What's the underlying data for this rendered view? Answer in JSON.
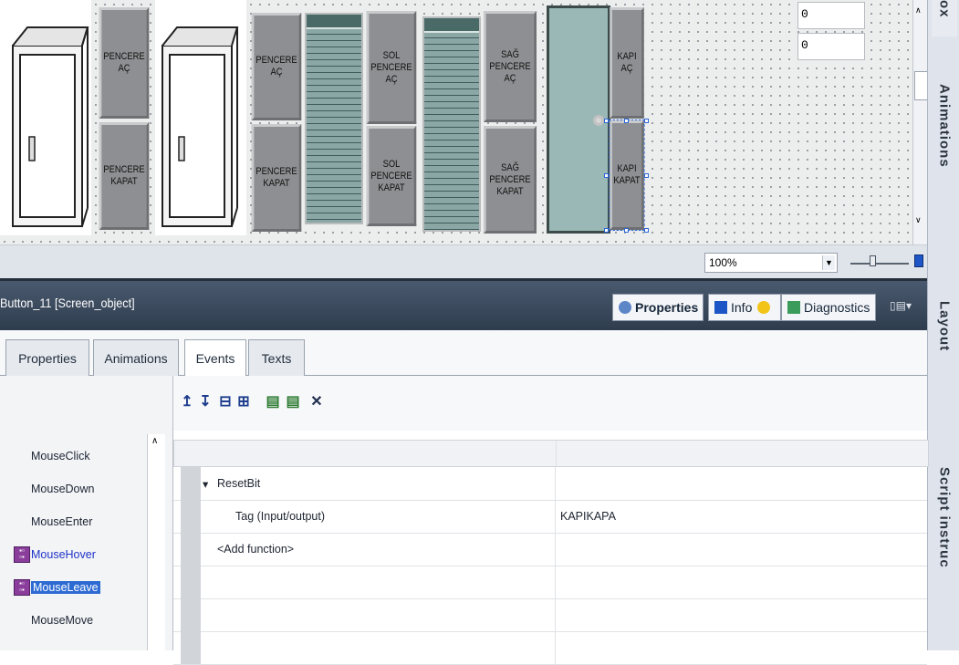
{
  "canvas": {
    "buttons": {
      "window1_open": "PENCERE\nAÇ",
      "window1_close": "PENCERE\nKAPAT",
      "window2_open": "PENCERE\nAÇ",
      "window2_close": "PENCERE\nKAPAT",
      "left_window_open": "SOL\nPENCERE\nAÇ",
      "left_window_close": "SOL\nPENCERE\nKAPAT",
      "right_window_open": "SAĞ\nPENCERE\nAÇ",
      "right_window_close": "SAĞ\nPENCERE\nKAPAT",
      "door_open": "KAPI\nAÇ",
      "door_close": "KAPI\nKAPAT"
    },
    "io_fields": [
      "0",
      "0"
    ]
  },
  "zoom": {
    "value": "100%"
  },
  "right_panel": {
    "tabs": [
      "ox",
      "Animations",
      "Layout",
      "Script instruc"
    ]
  },
  "inspector": {
    "object_title": "Button_11 [Screen_object]",
    "top_tabs": [
      "Properties",
      "Info",
      "Diagnostics"
    ],
    "tabs": [
      "Properties",
      "Animations",
      "Events",
      "Texts"
    ],
    "events": [
      "MouseClick",
      "MouseDown",
      "MouseEnter",
      "MouseHover",
      "MouseLeave",
      "MouseMove"
    ],
    "toolbar_icons": [
      "move-up-icon",
      "move-down-icon",
      "collapse-icon",
      "expand-icon",
      "vb-script-icon",
      "c-script-icon",
      "delete-icon"
    ],
    "function_list": {
      "function_name": "ResetBit",
      "param_name": "Tag (Input/output)",
      "param_value": "KAPIKAPA",
      "add_function": "<Add function>"
    }
  }
}
